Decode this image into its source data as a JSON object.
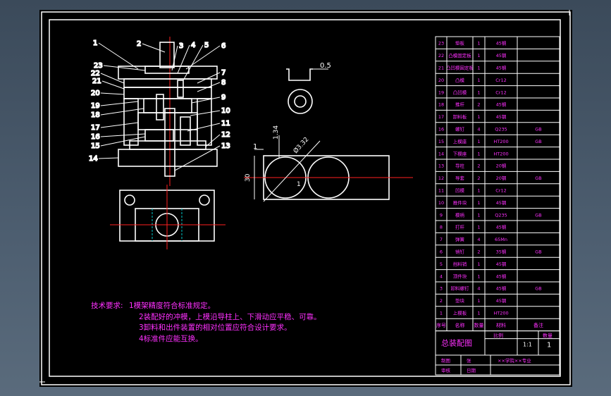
{
  "colors": {
    "background": "#3b4a5a",
    "sheet": "#000000",
    "frame": "#ffffff",
    "centerline": "#ff2020",
    "text": "#ff30ff",
    "hidden": "#00c8c8"
  },
  "assembly": {
    "part_labels": [
      "1",
      "2",
      "3",
      "4",
      "5",
      "6",
      "7",
      "8",
      "9",
      "10",
      "11",
      "12",
      "13",
      "14",
      "15",
      "16",
      "17",
      "18",
      "19",
      "20",
      "21",
      "22",
      "23"
    ]
  },
  "part_view": {
    "dim_thickness": "0.5"
  },
  "strip_layout": {
    "dim_left_gap": "1",
    "dim_1": "1.34",
    "dim_diameter": "Ø3.32",
    "dim_width": "30",
    "dim_mid_gap": "1"
  },
  "notes": {
    "heading": "技术要求:",
    "lines": [
      "1模架精度符合标准规定。",
      "2装配好的冲模，上模沿导柱上、下滑动应平稳、可靠。",
      "3卸料和出件装置的相对位置应符合设计要求。",
      "4标准件应能互换。"
    ]
  },
  "title_block": {
    "drawing_title": "总装配图",
    "header_row": [
      "序号",
      "名称",
      "数量",
      "材料",
      "备注"
    ],
    "meta_labels": [
      "比例",
      "数量"
    ],
    "scale": "1:1",
    "sheet_qty": "1",
    "sign_left": [
      "制图",
      "审核"
    ],
    "sign_mid": [
      "张",
      "日期"
    ],
    "school": "××学院××专业"
  },
  "bom": [
    {
      "no": "23",
      "name": "垫板",
      "qty": "1",
      "mat": "45钢",
      "note": ""
    },
    {
      "no": "22",
      "name": "凸模固定板",
      "qty": "1",
      "mat": "45钢",
      "note": ""
    },
    {
      "no": "21",
      "name": "凸凹模固定板",
      "qty": "1",
      "mat": "45钢",
      "note": ""
    },
    {
      "no": "20",
      "name": "凸模",
      "qty": "1",
      "mat": "Cr12",
      "note": ""
    },
    {
      "no": "19",
      "name": "凸凹模",
      "qty": "1",
      "mat": "Cr12",
      "note": ""
    },
    {
      "no": "18",
      "name": "推杆",
      "qty": "2",
      "mat": "45钢",
      "note": ""
    },
    {
      "no": "17",
      "name": "卸料板",
      "qty": "1",
      "mat": "45钢",
      "note": ""
    },
    {
      "no": "16",
      "name": "螺钉",
      "qty": "4",
      "mat": "Q235",
      "note": "GB"
    },
    {
      "no": "15",
      "name": "上模座",
      "qty": "1",
      "mat": "HT200",
      "note": "GB"
    },
    {
      "no": "14",
      "name": "下模座",
      "qty": "1",
      "mat": "HT200",
      "note": ""
    },
    {
      "no": "13",
      "name": "导柱",
      "qty": "2",
      "mat": "20钢",
      "note": ""
    },
    {
      "no": "12",
      "name": "导套",
      "qty": "2",
      "mat": "20钢",
      "note": "GB"
    },
    {
      "no": "11",
      "name": "凹模",
      "qty": "1",
      "mat": "Cr12",
      "note": ""
    },
    {
      "no": "10",
      "name": "推件块",
      "qty": "1",
      "mat": "45钢",
      "note": ""
    },
    {
      "no": "9",
      "name": "模柄",
      "qty": "1",
      "mat": "Q235",
      "note": "GB"
    },
    {
      "no": "8",
      "name": "打杆",
      "qty": "1",
      "mat": "45钢",
      "note": ""
    },
    {
      "no": "7",
      "name": "弹簧",
      "qty": "4",
      "mat": "65Mn",
      "note": ""
    },
    {
      "no": "6",
      "name": "销钉",
      "qty": "2",
      "mat": "35钢",
      "note": "GB"
    },
    {
      "no": "5",
      "name": "挡料销",
      "qty": "1",
      "mat": "45钢",
      "note": ""
    },
    {
      "no": "4",
      "name": "顶件块",
      "qty": "1",
      "mat": "45钢",
      "note": ""
    },
    {
      "no": "3",
      "name": "卸料螺钉",
      "qty": "4",
      "mat": "45钢",
      "note": "GB"
    },
    {
      "no": "2",
      "name": "垫块",
      "qty": "1",
      "mat": "45钢",
      "note": ""
    },
    {
      "no": "1",
      "name": "上模板",
      "qty": "1",
      "mat": "HT200",
      "note": ""
    }
  ]
}
